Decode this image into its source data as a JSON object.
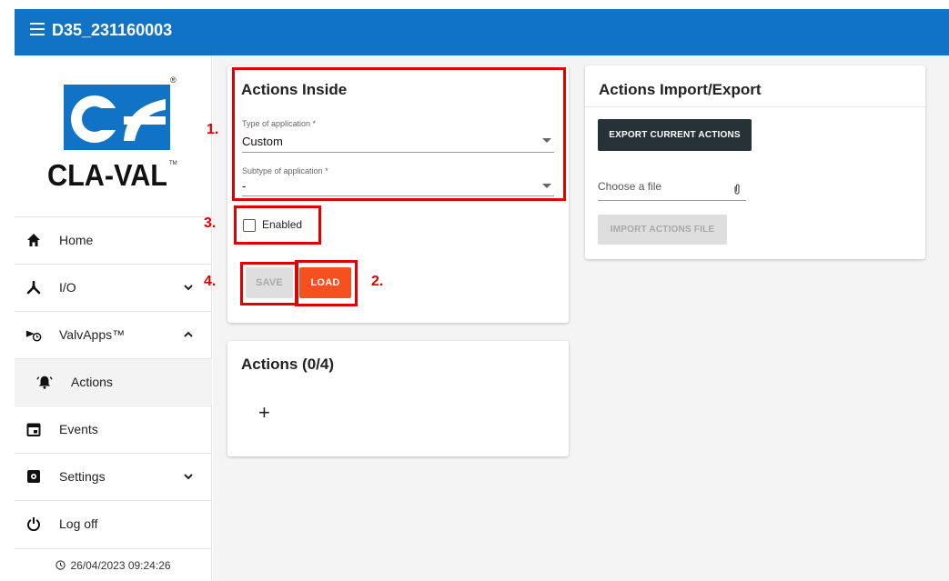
{
  "header": {
    "title": "D35_231160003"
  },
  "logo": {
    "text": "CLA-VAL",
    "tm": "TM",
    "reg": "®"
  },
  "sidebar": {
    "items": [
      {
        "label": "Home",
        "icon": "home-icon"
      },
      {
        "label": "I/O",
        "icon": "io-icon",
        "expand": "chevron-down"
      },
      {
        "label": "ValvApps™",
        "icon": "valvapps-icon",
        "expand": "chevron-up"
      },
      {
        "label": "Actions",
        "icon": "bell-alert-icon"
      },
      {
        "label": "Events",
        "icon": "calendar-icon"
      },
      {
        "label": "Settings",
        "icon": "settings-icon",
        "expand": "chevron-down"
      },
      {
        "label": "Log off",
        "icon": "power-icon"
      }
    ],
    "datetime": "26/04/2023 09:24:26"
  },
  "actions_inside": {
    "title": "Actions Inside",
    "type_label": "Type of application *",
    "type_value": "Custom",
    "subtype_label": "Subtype of application *",
    "subtype_value": "-",
    "enabled_label": "Enabled",
    "save_label": "SAVE",
    "load_label": "LOAD"
  },
  "actions_list": {
    "title": "Actions (0/4)",
    "add_symbol": "+"
  },
  "import_export": {
    "title": "Actions Import/Export",
    "export_label": "EXPORT CURRENT ACTIONS",
    "file_placeholder": "Choose a file",
    "import_label": "IMPORT ACTIONS FILE"
  },
  "annotations": {
    "n1": "1.",
    "n2": "2.",
    "n3": "3.",
    "n4": "4."
  },
  "colors": {
    "header": "#1173c6",
    "accent_orange": "#f4511e",
    "dark_button": "#263238",
    "annotation_red": "#e00000"
  }
}
